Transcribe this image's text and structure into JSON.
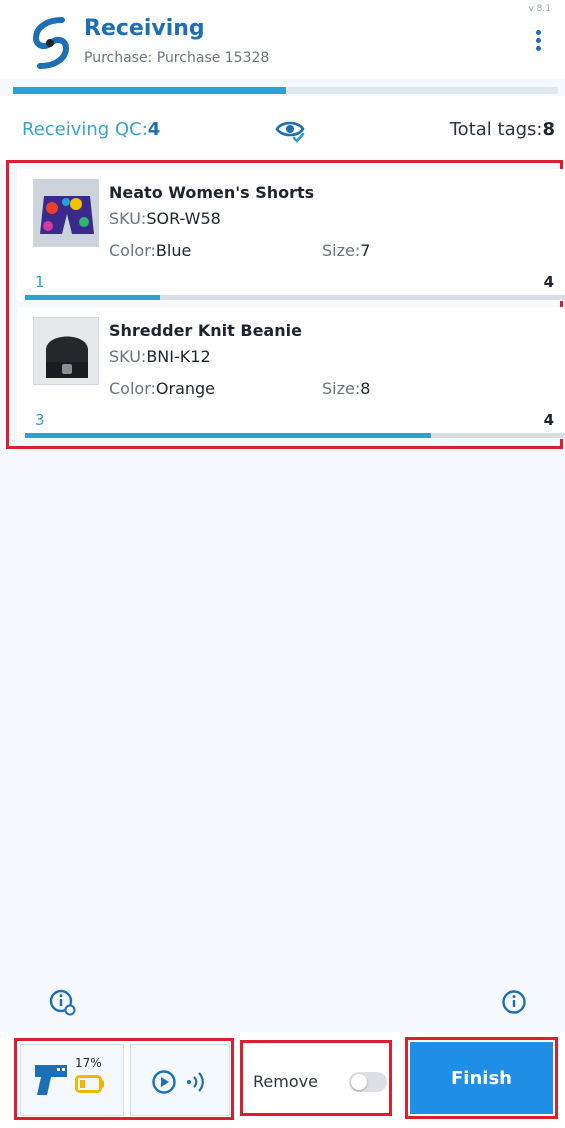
{
  "header": {
    "title": "Receiving",
    "subtitle": "Purchase: Purchase 15328",
    "version": "v 8.1"
  },
  "progress": {
    "overall": 0.5
  },
  "summary": {
    "qc_label": "Receiving QC:",
    "qc_value": "4",
    "tags_label": "Total tags:",
    "tags_value": "8"
  },
  "items": [
    {
      "name": "Neato Women's Shorts",
      "sku_label": "SKU:",
      "sku": "SOR-W58",
      "color_label": "Color:",
      "color": "Blue",
      "size_label": "Size:",
      "size": "7",
      "scanned": "1",
      "total": "4",
      "progress": 0.25
    },
    {
      "name": "Shredder Knit Beanie",
      "sku_label": "SKU:",
      "sku": "BNI-K12",
      "color_label": "Color:",
      "color": "Orange",
      "size_label": "Size:",
      "size": "8",
      "scanned": "3",
      "total": "4",
      "progress": 0.75
    }
  ],
  "footer": {
    "battery": "17%",
    "remove_label": "Remove",
    "remove_on": false,
    "finish_label": "Finish"
  },
  "colors": {
    "accent": "#1c6fb4",
    "progress": "#2ba2d2",
    "finish": "#1f8ee6",
    "battery": "#f5b400"
  }
}
